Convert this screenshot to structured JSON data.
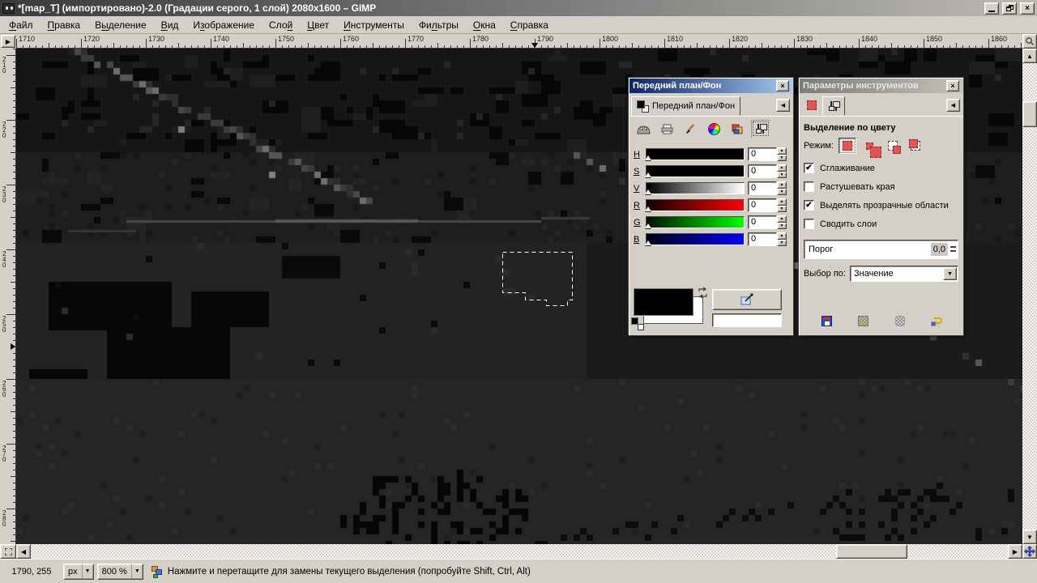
{
  "colors": {
    "chrome": "#d4d0c8",
    "canvas_bg": "#1e1e1e",
    "titlebar_active_left": "#0a246a",
    "titlebar_active_right": "#a6caf0",
    "selection_tool_red": "#e25555"
  },
  "window": {
    "title": "*[map_T] (импортировано)-2.0 (Градации серого, 1 слой) 2080x1600 – GIMP"
  },
  "menubar": {
    "items": [
      {
        "label": "Файл",
        "accel": 0
      },
      {
        "label": "Правка",
        "accel": 0
      },
      {
        "label": "Выделение",
        "accel": 1
      },
      {
        "label": "Вид",
        "accel": 0
      },
      {
        "label": "Изображение",
        "accel": 1
      },
      {
        "label": "Слой",
        "accel": 3
      },
      {
        "label": "Цвет",
        "accel": 0
      },
      {
        "label": "Инструменты",
        "accel": 0
      },
      {
        "label": "Фильтры",
        "accel": 2
      },
      {
        "label": "Окна",
        "accel": 0
      },
      {
        "label": "Справка",
        "accel": 0
      }
    ]
  },
  "rulers": {
    "top_labels": [
      "1710",
      "1720",
      "1730",
      "1740",
      "1750",
      "1760",
      "1770",
      "1780",
      "1790",
      "1800",
      "1810",
      "1820",
      "1830",
      "1840",
      "1850",
      "1860"
    ],
    "left_labels": [
      "210",
      "220",
      "230",
      "240",
      "250",
      "260",
      "270",
      "280"
    ]
  },
  "color_dialog": {
    "title": "Передний план/Фон",
    "tab_label": "Передний план/Фон",
    "channel_sliders": [
      {
        "label": "H",
        "value": "0"
      },
      {
        "label": "S",
        "value": "0"
      },
      {
        "label": "V",
        "value": "0"
      },
      {
        "label": "R",
        "value": "0"
      },
      {
        "label": "G",
        "value": "0"
      },
      {
        "label": "B",
        "value": "0"
      }
    ],
    "hex_entry": {
      "value": ""
    }
  },
  "tool_options": {
    "title": "Параметры инструментов",
    "header": "Выделение по цвету",
    "mode_label": "Режим:",
    "checkboxes": [
      {
        "label": "Сглаживание",
        "checked": true
      },
      {
        "label": "Растушевать края",
        "checked": false
      },
      {
        "label": "Выделять прозрачные области",
        "checked": true
      },
      {
        "label": "Сводить слои",
        "checked": false
      }
    ],
    "threshold": {
      "label": "Порог",
      "value": "0,0"
    },
    "select_by": {
      "label": "Выбор по:",
      "value": "Значение"
    }
  },
  "statusbar": {
    "position": "1790, 255",
    "unit": "px",
    "zoom": "800 %",
    "message": "Нажмите и перетащите для замены текущего выделения (попробуйте Shift, Ctrl, Alt)"
  }
}
